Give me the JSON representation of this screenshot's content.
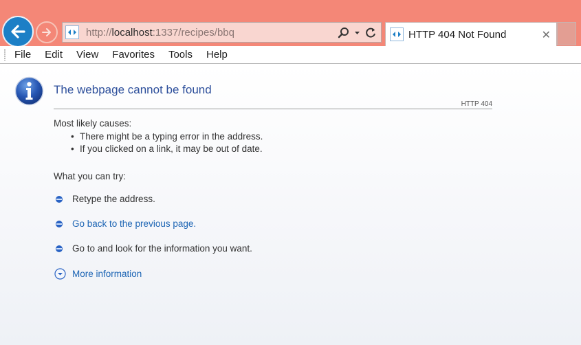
{
  "browser": {
    "address": {
      "url_prefix": "http://",
      "url_host": "localhost",
      "url_rest": ":1337/recipes/bbq"
    },
    "tab": {
      "title": "HTTP 404 Not Found",
      "close_glyph": "✕"
    },
    "colors": {
      "frame": "#f48777",
      "back_button": "#1c7fc6",
      "link": "#1c64b4",
      "heading": "#2d4f9b"
    }
  },
  "menu": {
    "items": [
      "File",
      "Edit",
      "View",
      "Favorites",
      "Tools",
      "Help"
    ]
  },
  "page": {
    "heading": "The webpage cannot be found",
    "error_code": "HTTP 404",
    "causes_label": "Most likely causes:",
    "causes": [
      "There might be a typing error in the address.",
      "If you clicked on a link, it may be out of date."
    ],
    "try_label": "What you can try:",
    "try_items": [
      "Retype the address.",
      "Go back to the previous page.",
      "Go to  and look for the information you want."
    ],
    "more_info": "More information"
  }
}
